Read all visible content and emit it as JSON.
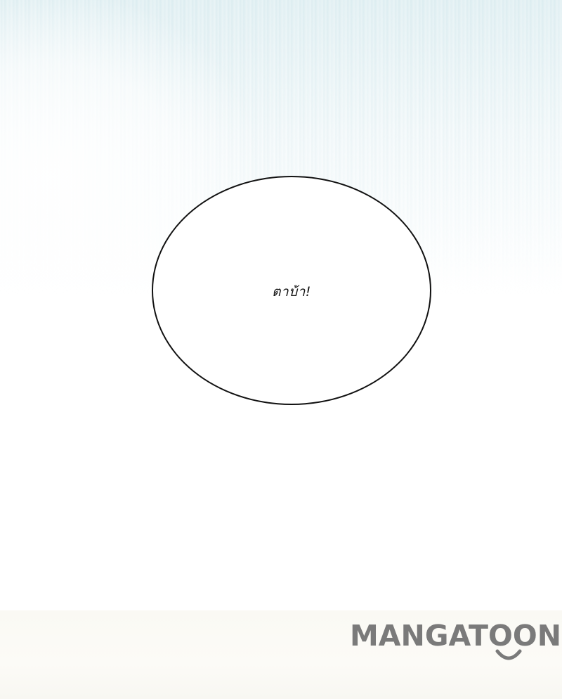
{
  "speech_bubble": {
    "text": "ตาบ้า!"
  },
  "watermark": {
    "text": "MANGATOON",
    "color": "#7a7a7a",
    "smile_icon": "smile-arc-icon"
  },
  "colors": {
    "background": "#ffffff",
    "top_wash": "#d6eaee",
    "bubble_outline": "#111111"
  }
}
